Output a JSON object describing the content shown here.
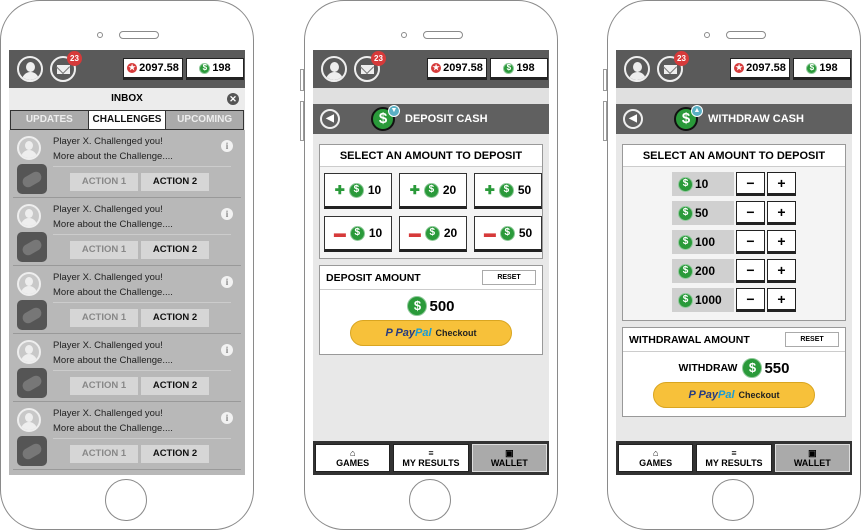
{
  "status": {
    "messages_badge": "23",
    "gems": "2097.58",
    "cash": "198"
  },
  "inbox": {
    "title": "INBOX",
    "tabs": [
      "UPDATES",
      "CHALLENGES",
      "UPCOMING"
    ],
    "active_tab": "CHALLENGES",
    "items": [
      {
        "line1": "Player X. Challenged you!",
        "line2": "More about the Challenge....",
        "action1": "ACTION 1",
        "action2": "ACTION 2"
      },
      {
        "line1": "Player X. Challenged you!",
        "line2": "More about the Challenge....",
        "action1": "ACTION 1",
        "action2": "ACTION 2"
      },
      {
        "line1": "Player X. Challenged you!",
        "line2": "More about the Challenge....",
        "action1": "ACTION 1",
        "action2": "ACTION 2"
      },
      {
        "line1": "Player X. Challenged you!",
        "line2": "More about the Challenge....",
        "action1": "ACTION 1",
        "action2": "ACTION 2"
      },
      {
        "line1": "Player X. Challenged you!",
        "line2": "More about the Challenge....",
        "action1": "ACTION 1",
        "action2": "ACTION 2"
      }
    ]
  },
  "deposit": {
    "title": "DEPOSIT CASH",
    "select_title": "SELECT AN AMOUNT TO DEPOSIT",
    "add_amounts": [
      "10",
      "20",
      "50"
    ],
    "remove_amounts": [
      "10",
      "20",
      "50"
    ],
    "amount_title": "DEPOSIT AMOUNT",
    "reset": "RESET",
    "total": "500",
    "paypal_brand_a": "Pay",
    "paypal_brand_b": "Pal",
    "paypal_checkout": "Checkout"
  },
  "withdraw": {
    "title": "WITHDRAW CASH",
    "select_title": "SELECT AN AMOUNT TO DEPOSIT",
    "amounts": [
      "10",
      "50",
      "100",
      "200",
      "1000"
    ],
    "minus": "−",
    "plus": "+",
    "amount_title": "WITHDRAWAL AMOUNT",
    "reset": "RESET",
    "withdraw_label": "WITHDRAW",
    "total": "550",
    "paypal_brand_a": "Pay",
    "paypal_brand_b": "Pal",
    "paypal_checkout": "Checkout"
  },
  "nav": {
    "games": "GAMES",
    "results": "MY RESULTS",
    "wallet": "WALLET",
    "active": "WALLET"
  },
  "colors": {
    "topbar": "#5a5a5a",
    "cash_green": "#2a9a3a",
    "alert_red": "#d63a3a",
    "paypal_yellow": "#f7c13a"
  }
}
